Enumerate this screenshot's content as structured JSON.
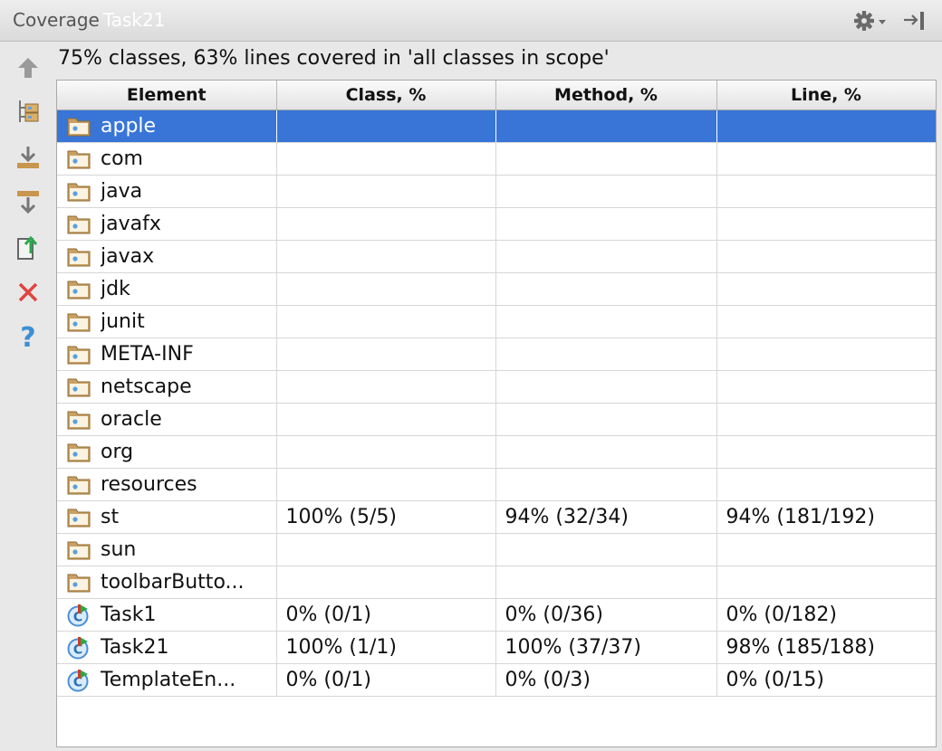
{
  "window": {
    "title": "Coverage",
    "run_name": "Task21",
    "icons": [
      "gear-icon",
      "hide-panel-icon"
    ]
  },
  "toolbar": {
    "icons": [
      "up-arrow-icon",
      "flatten-packages-icon",
      "generate-report-icon",
      "autoscroll-icon",
      "export-icon",
      "close-icon",
      "help-icon"
    ]
  },
  "summary": "75% classes, 63% lines covered in 'all classes in scope'",
  "table": {
    "columns": [
      "Element",
      "Class, %",
      "Method, %",
      "Line, %"
    ],
    "rows": [
      {
        "type": "package",
        "name": "apple",
        "class": "",
        "method": "",
        "line": "",
        "selected": true
      },
      {
        "type": "package",
        "name": "com",
        "class": "",
        "method": "",
        "line": ""
      },
      {
        "type": "package",
        "name": "java",
        "class": "",
        "method": "",
        "line": ""
      },
      {
        "type": "package",
        "name": "javafx",
        "class": "",
        "method": "",
        "line": ""
      },
      {
        "type": "package",
        "name": "javax",
        "class": "",
        "method": "",
        "line": ""
      },
      {
        "type": "package",
        "name": "jdk",
        "class": "",
        "method": "",
        "line": ""
      },
      {
        "type": "package",
        "name": "junit",
        "class": "",
        "method": "",
        "line": ""
      },
      {
        "type": "package",
        "name": "META-INF",
        "class": "",
        "method": "",
        "line": ""
      },
      {
        "type": "package",
        "name": "netscape",
        "class": "",
        "method": "",
        "line": ""
      },
      {
        "type": "package",
        "name": "oracle",
        "class": "",
        "method": "",
        "line": ""
      },
      {
        "type": "package",
        "name": "org",
        "class": "",
        "method": "",
        "line": ""
      },
      {
        "type": "package",
        "name": "resources",
        "class": "",
        "method": "",
        "line": ""
      },
      {
        "type": "package",
        "name": "st",
        "class": "100% (5/5)",
        "method": "94% (32/34)",
        "line": "94% (181/192)"
      },
      {
        "type": "package",
        "name": "sun",
        "class": "",
        "method": "",
        "line": ""
      },
      {
        "type": "package",
        "name": "toolbarButto...",
        "class": "",
        "method": "",
        "line": ""
      },
      {
        "type": "class",
        "name": "Task1",
        "class": "0% (0/1)",
        "method": "0% (0/36)",
        "line": "0% (0/182)"
      },
      {
        "type": "class",
        "name": "Task21",
        "class": "100% (1/1)",
        "method": "100% (37/37)",
        "line": "98% (185/188)"
      },
      {
        "type": "class",
        "name": "TemplateEn...",
        "class": "0% (0/1)",
        "method": "0% (0/3)",
        "line": "0% (0/15)"
      }
    ]
  },
  "colors": {
    "selection": "#3875d7",
    "folder": "#c8a064",
    "class_icon": "#4a8fd6"
  }
}
